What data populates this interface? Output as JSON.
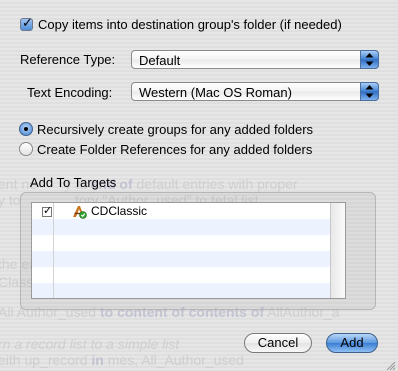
{
  "dialog": {
    "copy_items": {
      "label": "Copy items into destination group's folder (if needed)",
      "checked": true
    },
    "reference_type": {
      "label": "Reference Type:",
      "value": "Default"
    },
    "text_encoding": {
      "label": "Text Encoding:",
      "value": "Western (Mac OS Roman)"
    },
    "radio_options": [
      {
        "label": "Recursively create groups for any added folders",
        "selected": true
      },
      {
        "label": "Create Folder References for any added folders",
        "selected": false
      }
    ],
    "targets": {
      "title": "Add To Targets",
      "items": [
        {
          "name": "CDClassic",
          "checked": true
        }
      ]
    },
    "buttons": {
      "cancel": "Cancel",
      "add": "Add"
    }
  },
  "colors": {
    "accent_blue": "#3f7fd1",
    "row_alt": "#edf3fe",
    "target_icon_green": "#2e9e2e"
  }
}
